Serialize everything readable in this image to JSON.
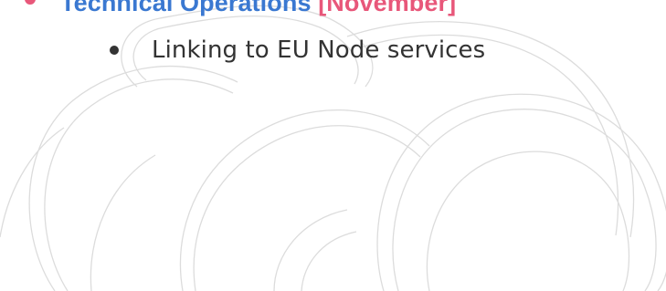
{
  "colors": {
    "heading": "#3a78d1",
    "accent": "#e8577a",
    "body_text": "#333333",
    "watermark": "#dcdcdc",
    "background": "#ffffff"
  },
  "heading": {
    "title": "Technical Operations",
    "tag": "[November]"
  },
  "bullets": [
    {
      "text": "Linking to EU Node services"
    }
  ]
}
